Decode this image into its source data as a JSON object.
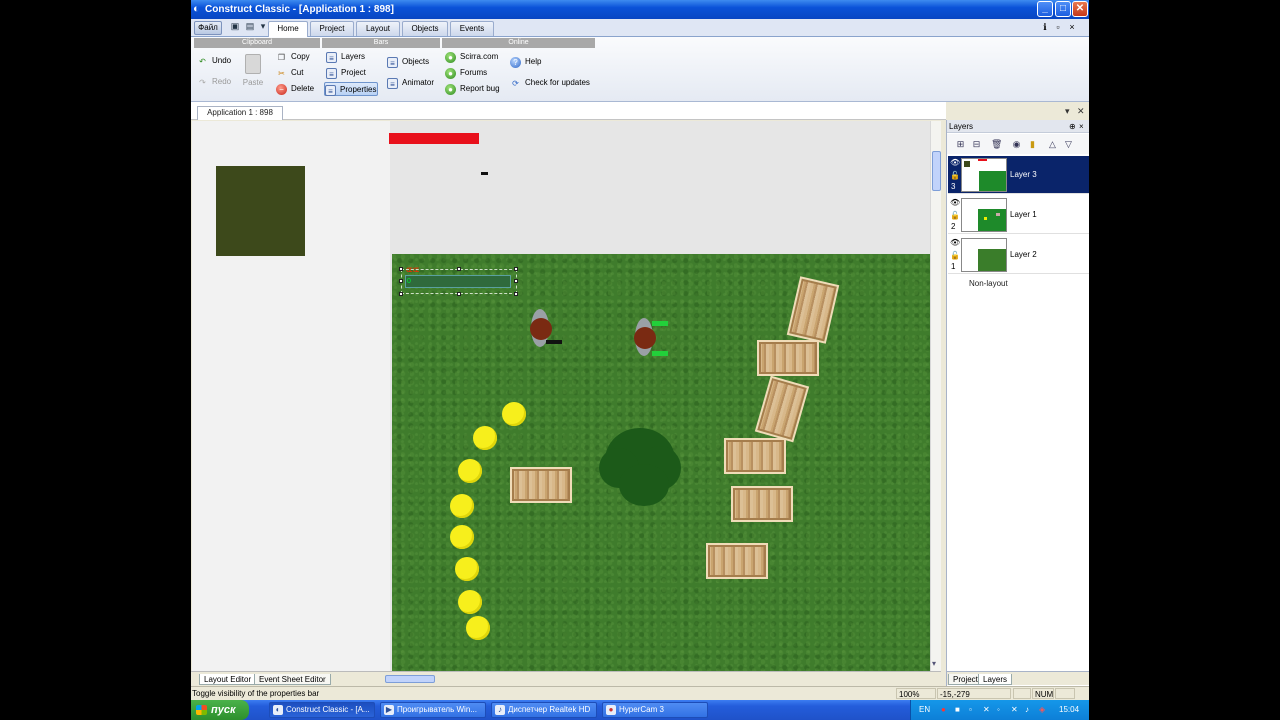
{
  "window": {
    "title": "Construct Classic - [Application 1 : 898]",
    "minimize": "_",
    "maximize": "□",
    "close": "✕"
  },
  "ribbon": {
    "file_label": "Файл",
    "tabs": [
      {
        "label": "Home",
        "active": true
      },
      {
        "label": "Project",
        "active": false
      },
      {
        "label": "Layout",
        "active": false
      },
      {
        "label": "Objects",
        "active": false
      },
      {
        "label": "Events",
        "active": false
      }
    ],
    "groups": {
      "clipboard": "Clipboard",
      "bars": "Bars",
      "online": "Online"
    },
    "buttons": {
      "undo": "Undo",
      "redo": "Redo",
      "paste": "Paste",
      "copy": "Copy",
      "cut": "Cut",
      "delete": "Delete",
      "layers": "Layers",
      "project": "Project",
      "properties": "Properties",
      "objects": "Objects",
      "animator": "Animator",
      "scirra": "Scirra.com",
      "forums": "Forums",
      "report_bug": "Report bug",
      "help": "Help",
      "check_updates": "Check for updates"
    }
  },
  "document": {
    "tab_label": "Application 1 : 898",
    "hud_text": "0"
  },
  "bottom_tabs": {
    "layout_editor": "Layout Editor",
    "event_sheet_editor": "Event Sheet Editor"
  },
  "status": {
    "message": "Toggle visibility of the properties bar",
    "zoom": "100%",
    "coords": "-15,-279",
    "num": "NUM"
  },
  "layers_panel": {
    "title": "Layers",
    "layers": [
      {
        "name": "Layer 3",
        "index": "3",
        "selected": true
      },
      {
        "name": "Layer 1",
        "index": "2",
        "selected": false
      },
      {
        "name": "Layer 2",
        "index": "1",
        "selected": false
      }
    ],
    "non_layout": "Non-layout",
    "tabs": {
      "project": "Project",
      "layers": "Layers"
    }
  },
  "taskbar": {
    "start": "пуск",
    "tasks": [
      {
        "label": "Construct Classic - [A...",
        "active": true
      },
      {
        "label": "Проигрыватель Win...",
        "active": false
      },
      {
        "label": "Диспетчер Realtek HD",
        "active": false
      },
      {
        "label": "HyperCam 3",
        "active": false
      }
    ],
    "lang": "EN",
    "time": "15:04"
  },
  "colors": {
    "accent": "#0a246a",
    "grass": "#3f7c2c",
    "health_bar": "#e8101b",
    "coin": "#f7ef1c"
  }
}
